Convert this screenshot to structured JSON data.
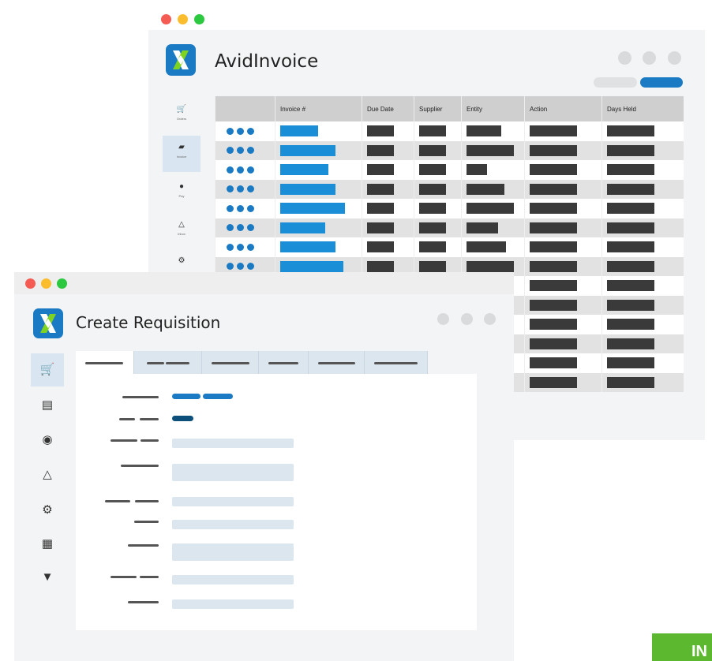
{
  "back_window": {
    "title": "AvidInvoice",
    "sidebar": [
      {
        "label": "Orders",
        "icon": "cart-icon"
      },
      {
        "label": "Invoice",
        "icon": "invoice-icon",
        "active": true
      },
      {
        "label": "Pay",
        "icon": "pay-icon"
      },
      {
        "label": "Inbox",
        "icon": "inbox-icon"
      },
      {
        "label": "",
        "icon": "settings-icon"
      }
    ],
    "table": {
      "columns": [
        "",
        "Invoice #",
        "Due Date",
        "Supplier",
        "Entity",
        "Action",
        "Days Held"
      ]
    }
  },
  "front_window": {
    "title": "Create Requisition",
    "sidebar": [
      {
        "icon": "cart-icon",
        "active": true
      },
      {
        "icon": "document-icon"
      },
      {
        "icon": "dollar-coin-icon"
      },
      {
        "icon": "inbox-icon"
      },
      {
        "icon": "settings-icon"
      },
      {
        "icon": "receipt-icon"
      },
      {
        "icon": "lightbulb-icon"
      }
    ]
  },
  "colors": {
    "accent_blue": "#1a7bc4",
    "bar_blue": "#1a8fd8",
    "dark_bar": "#3a3a3a",
    "active_nav": "#d9e6f2",
    "field_fill": "#dbe6ef",
    "corner_green": "#5cb82e"
  },
  "corner_text": "IN"
}
